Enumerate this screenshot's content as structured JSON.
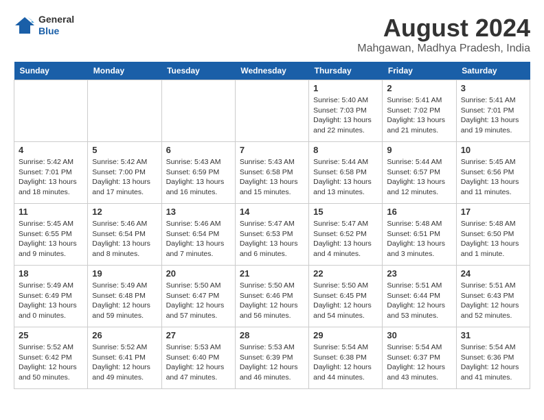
{
  "header": {
    "logo_line1": "General",
    "logo_line2": "Blue",
    "title": "August 2024",
    "subtitle": "Mahgawan, Madhya Pradesh, India"
  },
  "days_of_week": [
    "Sunday",
    "Monday",
    "Tuesday",
    "Wednesday",
    "Thursday",
    "Friday",
    "Saturday"
  ],
  "weeks": [
    [
      {
        "day": "",
        "info": ""
      },
      {
        "day": "",
        "info": ""
      },
      {
        "day": "",
        "info": ""
      },
      {
        "day": "",
        "info": ""
      },
      {
        "day": "1",
        "info": "Sunrise: 5:40 AM\nSunset: 7:03 PM\nDaylight: 13 hours and 22 minutes."
      },
      {
        "day": "2",
        "info": "Sunrise: 5:41 AM\nSunset: 7:02 PM\nDaylight: 13 hours and 21 minutes."
      },
      {
        "day": "3",
        "info": "Sunrise: 5:41 AM\nSunset: 7:01 PM\nDaylight: 13 hours and 19 minutes."
      }
    ],
    [
      {
        "day": "4",
        "info": "Sunrise: 5:42 AM\nSunset: 7:01 PM\nDaylight: 13 hours and 18 minutes."
      },
      {
        "day": "5",
        "info": "Sunrise: 5:42 AM\nSunset: 7:00 PM\nDaylight: 13 hours and 17 minutes."
      },
      {
        "day": "6",
        "info": "Sunrise: 5:43 AM\nSunset: 6:59 PM\nDaylight: 13 hours and 16 minutes."
      },
      {
        "day": "7",
        "info": "Sunrise: 5:43 AM\nSunset: 6:58 PM\nDaylight: 13 hours and 15 minutes."
      },
      {
        "day": "8",
        "info": "Sunrise: 5:44 AM\nSunset: 6:58 PM\nDaylight: 13 hours and 13 minutes."
      },
      {
        "day": "9",
        "info": "Sunrise: 5:44 AM\nSunset: 6:57 PM\nDaylight: 13 hours and 12 minutes."
      },
      {
        "day": "10",
        "info": "Sunrise: 5:45 AM\nSunset: 6:56 PM\nDaylight: 13 hours and 11 minutes."
      }
    ],
    [
      {
        "day": "11",
        "info": "Sunrise: 5:45 AM\nSunset: 6:55 PM\nDaylight: 13 hours and 9 minutes."
      },
      {
        "day": "12",
        "info": "Sunrise: 5:46 AM\nSunset: 6:54 PM\nDaylight: 13 hours and 8 minutes."
      },
      {
        "day": "13",
        "info": "Sunrise: 5:46 AM\nSunset: 6:54 PM\nDaylight: 13 hours and 7 minutes."
      },
      {
        "day": "14",
        "info": "Sunrise: 5:47 AM\nSunset: 6:53 PM\nDaylight: 13 hours and 6 minutes."
      },
      {
        "day": "15",
        "info": "Sunrise: 5:47 AM\nSunset: 6:52 PM\nDaylight: 13 hours and 4 minutes."
      },
      {
        "day": "16",
        "info": "Sunrise: 5:48 AM\nSunset: 6:51 PM\nDaylight: 13 hours and 3 minutes."
      },
      {
        "day": "17",
        "info": "Sunrise: 5:48 AM\nSunset: 6:50 PM\nDaylight: 13 hours and 1 minute."
      }
    ],
    [
      {
        "day": "18",
        "info": "Sunrise: 5:49 AM\nSunset: 6:49 PM\nDaylight: 13 hours and 0 minutes."
      },
      {
        "day": "19",
        "info": "Sunrise: 5:49 AM\nSunset: 6:48 PM\nDaylight: 12 hours and 59 minutes."
      },
      {
        "day": "20",
        "info": "Sunrise: 5:50 AM\nSunset: 6:47 PM\nDaylight: 12 hours and 57 minutes."
      },
      {
        "day": "21",
        "info": "Sunrise: 5:50 AM\nSunset: 6:46 PM\nDaylight: 12 hours and 56 minutes."
      },
      {
        "day": "22",
        "info": "Sunrise: 5:50 AM\nSunset: 6:45 PM\nDaylight: 12 hours and 54 minutes."
      },
      {
        "day": "23",
        "info": "Sunrise: 5:51 AM\nSunset: 6:44 PM\nDaylight: 12 hours and 53 minutes."
      },
      {
        "day": "24",
        "info": "Sunrise: 5:51 AM\nSunset: 6:43 PM\nDaylight: 12 hours and 52 minutes."
      }
    ],
    [
      {
        "day": "25",
        "info": "Sunrise: 5:52 AM\nSunset: 6:42 PM\nDaylight: 12 hours and 50 minutes."
      },
      {
        "day": "26",
        "info": "Sunrise: 5:52 AM\nSunset: 6:41 PM\nDaylight: 12 hours and 49 minutes."
      },
      {
        "day": "27",
        "info": "Sunrise: 5:53 AM\nSunset: 6:40 PM\nDaylight: 12 hours and 47 minutes."
      },
      {
        "day": "28",
        "info": "Sunrise: 5:53 AM\nSunset: 6:39 PM\nDaylight: 12 hours and 46 minutes."
      },
      {
        "day": "29",
        "info": "Sunrise: 5:54 AM\nSunset: 6:38 PM\nDaylight: 12 hours and 44 minutes."
      },
      {
        "day": "30",
        "info": "Sunrise: 5:54 AM\nSunset: 6:37 PM\nDaylight: 12 hours and 43 minutes."
      },
      {
        "day": "31",
        "info": "Sunrise: 5:54 AM\nSunset: 6:36 PM\nDaylight: 12 hours and 41 minutes."
      }
    ]
  ]
}
